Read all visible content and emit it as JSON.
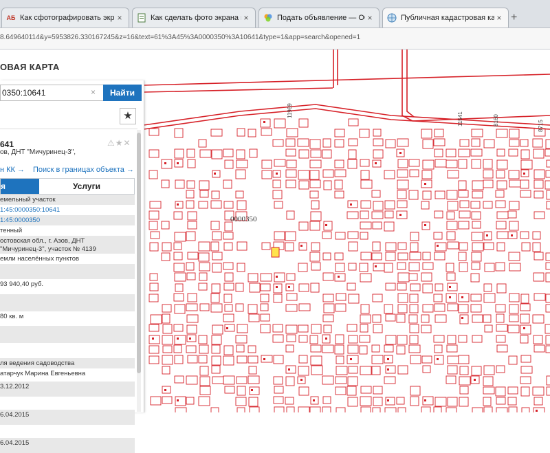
{
  "browser": {
    "tabs": [
      {
        "label": "Как сфотографировать экра",
        "favicon": "АБ",
        "active": false
      },
      {
        "label": "Как сделать фото экрана на",
        "favicon": "doc",
        "active": false
      },
      {
        "label": "Подать объявление — Объ",
        "favicon": "colors",
        "active": false
      },
      {
        "label": "Публичная кадастровая кар",
        "favicon": "globe",
        "active": true
      }
    ],
    "new_tab": "+",
    "close_glyph": "×",
    "url": "8.649640114&y=5953826.330167245&z=16&text=61%3A45%3A0000350%3A10641&type=1&app=search&opened=1"
  },
  "app": {
    "title": "ОВАЯ КАРТА"
  },
  "search": {
    "value": "0350:10641",
    "clear": "×",
    "button": "Найти"
  },
  "favorites_icon": "★",
  "object": {
    "id": "641",
    "tools": "⚠★✕",
    "address_line": "ов, ДНТ \"Мичуринец-3\",",
    "link_kk": "н КК →",
    "link_search": "Поиск в границах объекта →",
    "tab_info": "я",
    "tab_services": "Услуги"
  },
  "attributes": [
    {
      "text": "емельный участок",
      "shade": true,
      "link": false
    },
    {
      "text": "1:45:0000350:10641",
      "shade": false,
      "link": true
    },
    {
      "text": "1:45:0000350",
      "shade": true,
      "link": true
    },
    {
      "text": "тенный",
      "shade": false,
      "link": false
    },
    {
      "text": "остовская обл., г. Азов, ДНТ",
      "text2": "\"Мичуринец-3\", участок № 4139",
      "shade": true,
      "link": false
    },
    {
      "text": "емли населённых пунктов",
      "shade": false,
      "link": false
    },
    {
      "text": "",
      "shade": true,
      "link": false
    },
    {
      "text": "93 940,40 руб.",
      "shade": false,
      "link": false
    },
    {
      "text": "",
      "shade": true,
      "link": false
    },
    {
      "text": "80 кв. м",
      "shade": false,
      "link": false
    },
    {
      "text": "",
      "shade": true,
      "link": false
    },
    {
      "text": "",
      "shade": false,
      "link": false
    },
    {
      "text": "ля ведения садоводства",
      "shade": true,
      "link": false
    },
    {
      "text": "атарчук Марина Евгеньевна",
      "shade": false,
      "link": false
    },
    {
      "text": "3.12.2012",
      "shade": true,
      "link": false
    },
    {
      "text": "",
      "shade": false,
      "link": false
    },
    {
      "text": "6.04.2015",
      "shade": true,
      "link": false
    },
    {
      "text": "",
      "shade": false,
      "link": false
    },
    {
      "text": "6.04.2015",
      "shade": true,
      "link": false
    }
  ],
  "map": {
    "quarter_label": "0000350",
    "road_labels": [
      "11969",
      "11541",
      "8160",
      "8715"
    ],
    "line_color": "#d62027",
    "highlight_color": "#ffe34d"
  }
}
